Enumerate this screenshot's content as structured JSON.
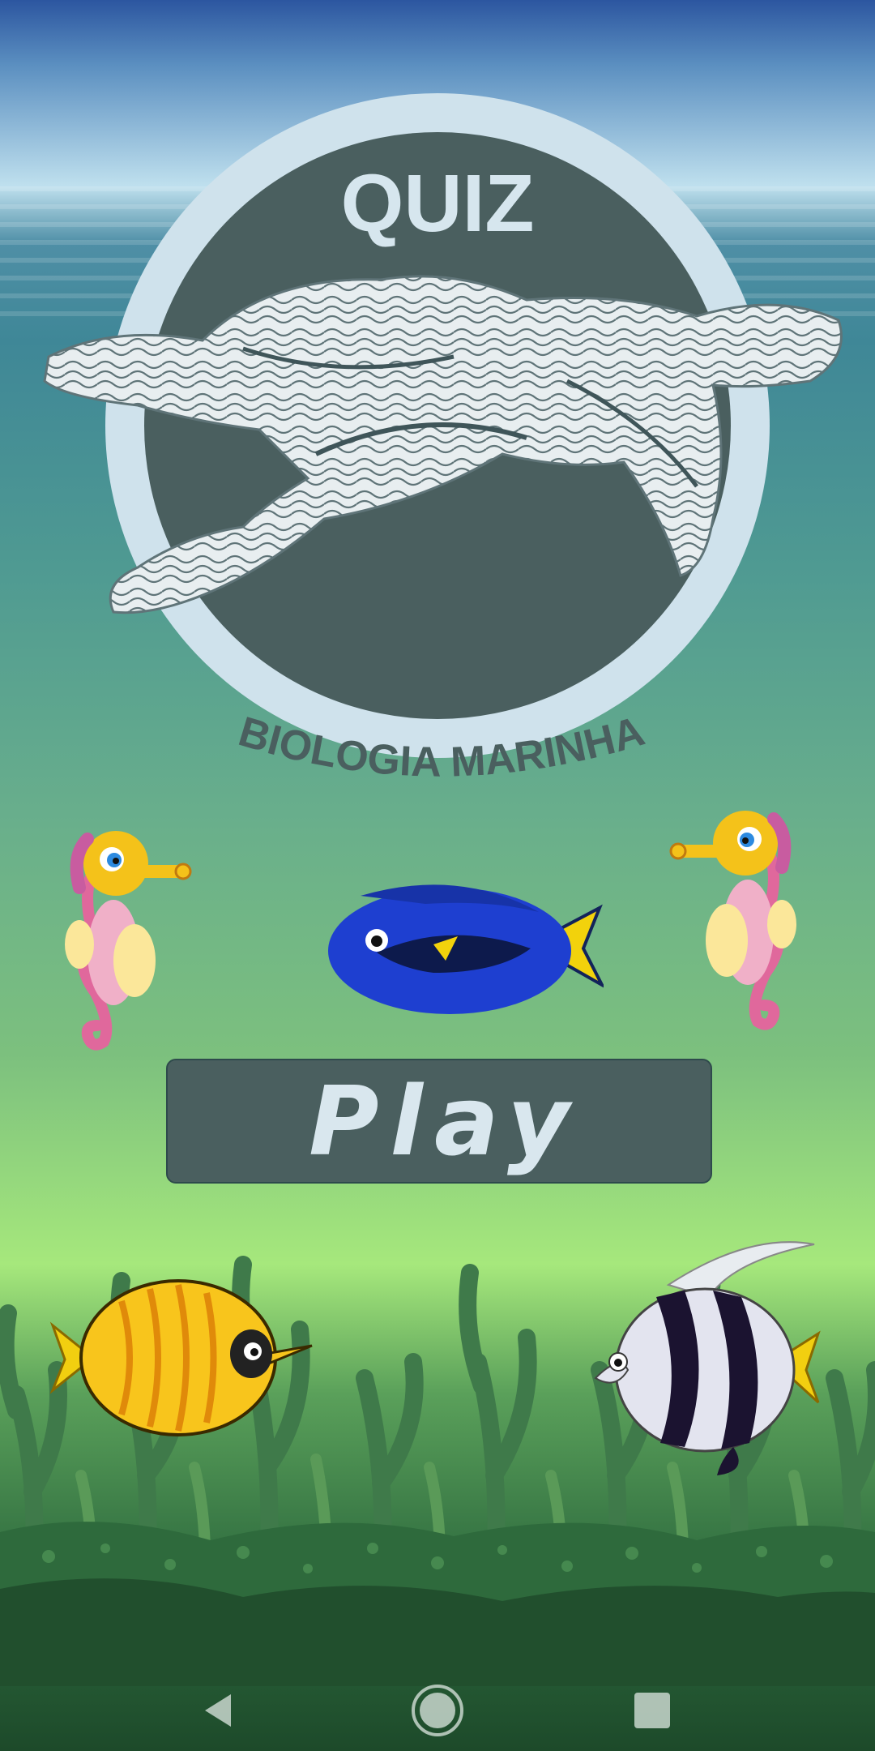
{
  "logo": {
    "title": "QUIZ",
    "subtitle": "BIOLOGIA MARINHA"
  },
  "play_button": {
    "label": "Play"
  },
  "creatures": [
    "seahorse-left",
    "blue-tang-fish",
    "seahorse-right",
    "yellow-butterflyfish",
    "striped-angelfish"
  ],
  "navigation": {
    "back": "back-icon",
    "home": "home-icon",
    "recents": "recents-icon"
  },
  "colors": {
    "logo_disc": "#4a5f5f",
    "logo_ring": "#cfe2ec",
    "button_bg": "#4a5f5f",
    "button_text": "#d9e7ee"
  }
}
